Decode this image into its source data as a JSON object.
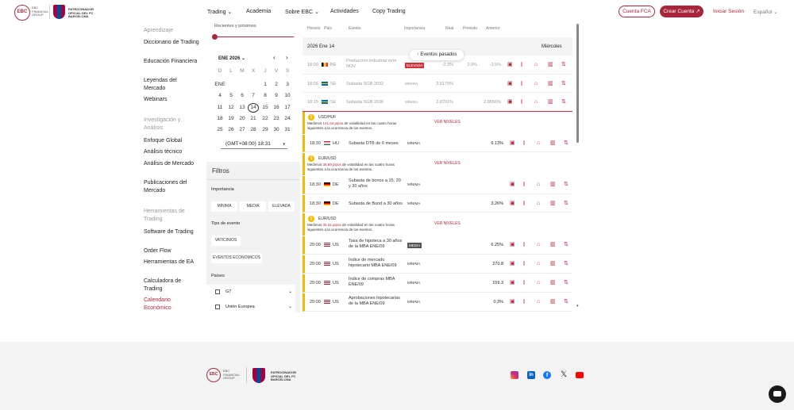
{
  "header": {
    "logo_text": "EBC FINANCIAL GROUP",
    "sponsor_text": "PATROCINADOR OFICIAL DEL FC BARCELONA",
    "nav": [
      "Trading",
      "Academia",
      "Sobre EBC",
      "Actividades",
      "Copy Trading"
    ],
    "btn_fca": "Cuenta FCA",
    "btn_create": "Crear Cuenta",
    "login": "Iniciar Sesión",
    "lang": "Español"
  },
  "sidebar": {
    "sections": [
      {
        "title": "Aprendizaje",
        "items": [
          "Diccionario de Trading",
          "Educación Financiera",
          "Leyendas del Mercado",
          "Webinars"
        ]
      },
      {
        "title": "Investigación y Análisis",
        "items": [
          "Enfoque Global",
          "Análisis técnico",
          "Análisis de Mercado",
          "Publicaciones del Mercado"
        ]
      },
      {
        "title": "Herramientas de Trading",
        "items": [
          "Software de Trading",
          "Order Flow",
          "Herramientas de EA",
          "Calculadora de Trading",
          "Calendario Económico"
        ]
      }
    ],
    "active": "Calendario Económico"
  },
  "calendar": {
    "range_label": "Recientes y próximos",
    "month": "ENE 2026",
    "weekdays": [
      "D",
      "L",
      "M",
      "X",
      "J",
      "V",
      "S"
    ],
    "month_short": "ENE",
    "days": [
      "1",
      "2",
      "3",
      "4",
      "5",
      "6",
      "7",
      "8",
      "9",
      "10",
      "11",
      "12",
      "13",
      "14",
      "15",
      "16",
      "17",
      "18",
      "19",
      "20",
      "21",
      "22",
      "23",
      "24",
      "25",
      "26",
      "27",
      "28",
      "29",
      "30",
      "31"
    ],
    "selected": "14",
    "timezone": "(GMT+08:00) 18:31"
  },
  "filters": {
    "title": "Filtros",
    "importance_label": "Importancia",
    "importance": [
      "MÍNIMA",
      "MEDIA",
      "ELEVADA"
    ],
    "event_type_label": "Tipo de evento",
    "event_types": [
      "VATICINIOS",
      "EVENTOS ECONÓMICOS"
    ],
    "countries_label": "Países",
    "countries": [
      "G7",
      "Unión Europea"
    ]
  },
  "table": {
    "headers": [
      "Horario",
      "País",
      "Evento",
      "Importancia",
      "Real",
      "Previsto",
      "Anterior"
    ],
    "date_label": "2026 Ene 14",
    "day_label": "Miércoles",
    "past_events_btn": "Eventos pasados",
    "ver_niveles": "VER NIVELES",
    "past_rows": [
      {
        "time": "18:00",
        "country": "BE",
        "event": "Producción industrial m/m NOV",
        "importance": "ELEVADA",
        "real": "-2.3%",
        "prev": "2.9%",
        "ant": "-3.5%"
      },
      {
        "time": "18:05",
        "country": "SE",
        "event": "Subasta SGB 2032",
        "importance": "MÍNIMA",
        "real": "2.5179%",
        "prev": "",
        "ant": ""
      },
      {
        "time": "18:15",
        "country": "SE",
        "event": "Subasta SGB 2036",
        "importance": "MÍNIMA",
        "real": "2.8701%",
        "prev": "",
        "ant": "2.8556%"
      }
    ],
    "groups": [
      {
        "pair": "USD/HUF",
        "vol_pre": "Medimos ",
        "vol_val": "141.64 pipos",
        "vol_post": " de volatilidad en las cuatro horas siguientes a la ocurrencia de los eventos.",
        "rows": [
          {
            "time": "18:30",
            "country": "HU",
            "event": "Subasta DTB de 6 meses",
            "importance": "MÍNIMA",
            "real": "",
            "prev": "",
            "ant": "6.13%"
          }
        ]
      },
      {
        "pair": "EUR/USD",
        "vol_pre": "Medimos ",
        "vol_val": "35.59 pipos",
        "vol_post": " de volatilidad en las cuatro horas siguientes a la ocurrencia de los eventos.",
        "rows": [
          {
            "time": "18:30",
            "country": "DE",
            "event": "Subasta de bonos a 15, 20 y 30 años",
            "importance": "MÍNIMA",
            "real": "",
            "prev": "",
            "ant": ""
          },
          {
            "time": "18:30",
            "country": "DE",
            "event": "Subasta de Bund a 30 años",
            "importance": "MÍNIMA",
            "real": "",
            "prev": "",
            "ant": "3.26%"
          }
        ]
      },
      {
        "pair": "EUR/USD",
        "vol_pre": "Medimos ",
        "vol_val": "30.31 pipos",
        "vol_post": " de volatilidad en las cuatro horas siguientes a la ocurrencia de los eventos.",
        "rows": [
          {
            "time": "20:00",
            "country": "US",
            "event": "Tasa de hipoteca a 30 años de la MBA ENE/09",
            "importance": "MEDIA",
            "real": "",
            "prev": "",
            "ant": "6.25%"
          },
          {
            "time": "20:00",
            "country": "US",
            "event": "Índice de mercado hipotecario MBA ENE/09",
            "importance": "MÍNIMA",
            "real": "",
            "prev": "",
            "ant": "270.8"
          },
          {
            "time": "20:00",
            "country": "US",
            "event": "Índice de compras MBA ENE/09",
            "importance": "MÍNIMA",
            "real": "",
            "prev": "",
            "ant": "159.3"
          },
          {
            "time": "20:00",
            "country": "US",
            "event": "Aprobaciones hipotecarias de la MBA ENE/09",
            "importance": "MÍNIMA",
            "real": "",
            "prev": "",
            "ant": "0.3%"
          }
        ]
      }
    ]
  },
  "footer": {
    "logo_text": "EBC FINANCIAL GROUP",
    "sponsor_text": "PATROCINADOR OFICIAL DEL FC BARCELONA",
    "social": [
      "instagram-icon",
      "linkedin-icon",
      "facebook-icon",
      "x-icon",
      "youtube-icon"
    ]
  },
  "colors": {
    "brand": "#a8243a",
    "accent": "#f5b800"
  }
}
